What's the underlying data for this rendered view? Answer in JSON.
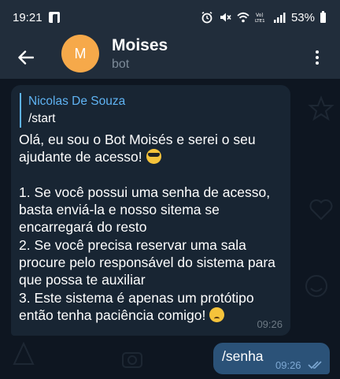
{
  "status_bar": {
    "time": "19:21",
    "battery": "53%",
    "icons": [
      "facebook-icon",
      "alarm-icon",
      "mute-icon",
      "wifi-icon",
      "volte-icon",
      "signal-icon",
      "battery-icon"
    ]
  },
  "header": {
    "avatar_letter": "M",
    "avatar_color": "#f6a94a",
    "name": "Moises",
    "subtitle": "bot"
  },
  "incoming_message": {
    "reply_author": "Nicolas De Souza",
    "reply_text": "/start",
    "line1": "Olá, eu sou o Bot Moisés e serei o seu ajudante de acesso!",
    "body": "1. Se você possui uma senha de acesso, basta enviá-la e nosso sitema se encarregará do resto\n2. Se você precisa reservar uma sala procure pelo responsável do sistema para que possa te auxiliar\n3. Este sistema é apenas um protótipo então tenha paciência comigo!",
    "time": "09:26"
  },
  "outgoing_message": {
    "text": "/senha",
    "time": "09:26"
  },
  "colors": {
    "background": "#0e1621",
    "header": "#212d3b",
    "incoming_bubble": "#182533",
    "outgoing_bubble": "#2b5278",
    "accent": "#5fb3f3"
  }
}
